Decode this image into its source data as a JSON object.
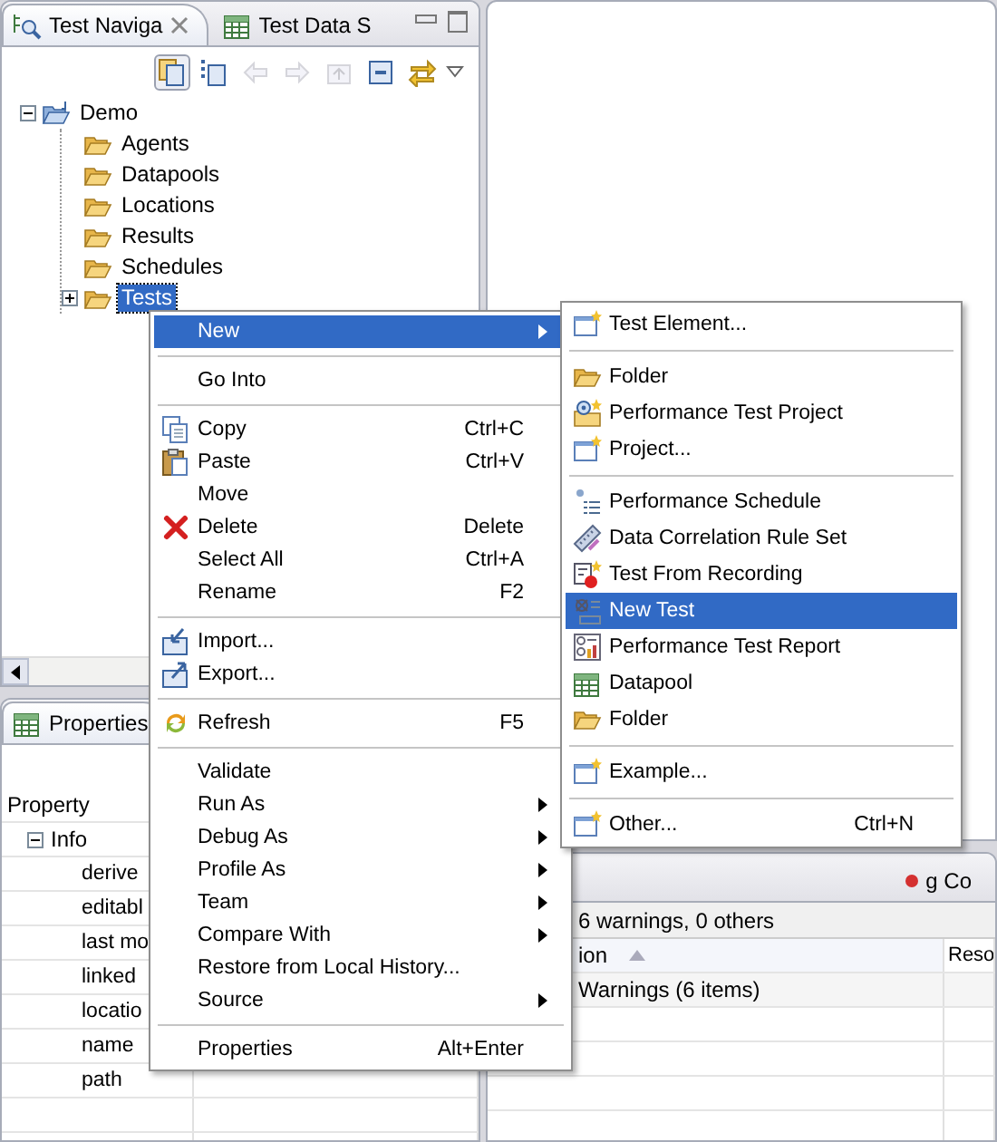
{
  "navigator": {
    "tabs": [
      {
        "label": "Test Naviga",
        "selected": true
      },
      {
        "label": "Test Data S",
        "selected": false
      }
    ],
    "toolbar": [
      {
        "pressed": true,
        "disabled": false
      },
      {
        "pressed": false,
        "disabled": false
      },
      {
        "pressed": false,
        "disabled": true
      },
      {
        "pressed": false,
        "disabled": true
      },
      {
        "pressed": false,
        "disabled": true
      },
      {
        "pressed": false,
        "disabled": false
      },
      {
        "pressed": false,
        "disabled": false
      }
    ],
    "tree": [
      {
        "label": "Demo",
        "expanded": true,
        "selected": false,
        "children": [
          {
            "label": "Agents",
            "selected": false
          },
          {
            "label": "Datapools",
            "selected": false
          },
          {
            "label": "Locations",
            "selected": false
          },
          {
            "label": "Results",
            "selected": false
          },
          {
            "label": "Schedules",
            "selected": false
          },
          {
            "label": "Tests",
            "expanded": false,
            "selected": true
          }
        ]
      }
    ]
  },
  "properties": {
    "tab": "Properties",
    "column": "Property",
    "groups": [
      {
        "label": "Info",
        "expanded": true,
        "rows": [
          "derive",
          "editabl",
          "last mo",
          "linked",
          "locatio",
          "name",
          "path"
        ]
      }
    ]
  },
  "problems": {
    "tab": "g Co",
    "summary": "6 warnings, 0 others",
    "columns": [
      {
        "label": "ion",
        "sorted": true
      },
      {
        "label": "Reso"
      }
    ],
    "rows": [
      "Warnings (6 items)"
    ]
  },
  "context_menu": {
    "items": [
      {
        "kind": "item",
        "label": "New",
        "submenu": true,
        "selected": true
      },
      {
        "kind": "separator"
      },
      {
        "kind": "item",
        "label": "Go Into",
        "selected": false
      },
      {
        "kind": "separator"
      },
      {
        "kind": "item",
        "label": "Copy",
        "shortcut": "Ctrl+C",
        "selected": false
      },
      {
        "kind": "item",
        "label": "Paste",
        "shortcut": "Ctrl+V",
        "selected": false
      },
      {
        "kind": "item",
        "label": "Move",
        "selected": false
      },
      {
        "kind": "item",
        "label": "Delete",
        "shortcut": "Delete",
        "selected": false
      },
      {
        "kind": "item",
        "label": "Select All",
        "shortcut": "Ctrl+A",
        "selected": false
      },
      {
        "kind": "item",
        "label": "Rename",
        "shortcut": "F2",
        "selected": false
      },
      {
        "kind": "separator"
      },
      {
        "kind": "item",
        "label": "Import...",
        "selected": false
      },
      {
        "kind": "item",
        "label": "Export...",
        "selected": false
      },
      {
        "kind": "separator"
      },
      {
        "kind": "item",
        "label": "Refresh",
        "shortcut": "F5",
        "selected": false
      },
      {
        "kind": "separator"
      },
      {
        "kind": "item",
        "label": "Validate",
        "selected": false
      },
      {
        "kind": "item",
        "label": "Run As",
        "submenu": true,
        "selected": false
      },
      {
        "kind": "item",
        "label": "Debug As",
        "submenu": true,
        "selected": false
      },
      {
        "kind": "item",
        "label": "Profile As",
        "submenu": true,
        "selected": false
      },
      {
        "kind": "item",
        "label": "Team",
        "submenu": true,
        "selected": false
      },
      {
        "kind": "item",
        "label": "Compare With",
        "submenu": true,
        "selected": false
      },
      {
        "kind": "item",
        "label": "Restore from Local History...",
        "selected": false
      },
      {
        "kind": "item",
        "label": "Source",
        "submenu": true,
        "selected": false
      },
      {
        "kind": "separator"
      },
      {
        "kind": "item",
        "label": "Properties",
        "shortcut": "Alt+Enter",
        "selected": false
      }
    ]
  },
  "submenu": {
    "items": [
      {
        "kind": "item",
        "label": "Test Element...",
        "selected": false
      },
      {
        "kind": "separator"
      },
      {
        "kind": "item",
        "label": "Folder",
        "selected": false
      },
      {
        "kind": "item",
        "label": "Performance Test Project",
        "selected": false
      },
      {
        "kind": "item",
        "label": "Project...",
        "selected": false
      },
      {
        "kind": "separator"
      },
      {
        "kind": "item",
        "label": "Performance Schedule",
        "selected": false
      },
      {
        "kind": "item",
        "label": "Data Correlation Rule Set",
        "selected": false
      },
      {
        "kind": "item",
        "label": "Test From Recording",
        "selected": false
      },
      {
        "kind": "item",
        "label": "New Test",
        "selected": true
      },
      {
        "kind": "item",
        "label": "Performance Test Report",
        "selected": false
      },
      {
        "kind": "item",
        "label": "Datapool",
        "selected": false
      },
      {
        "kind": "item",
        "label": "Folder",
        "selected": false
      },
      {
        "kind": "separator"
      },
      {
        "kind": "item",
        "label": "Example...",
        "selected": false
      },
      {
        "kind": "separator"
      },
      {
        "kind": "item",
        "label": "Other...",
        "shortcut": "Ctrl+N",
        "selected": false
      }
    ]
  }
}
